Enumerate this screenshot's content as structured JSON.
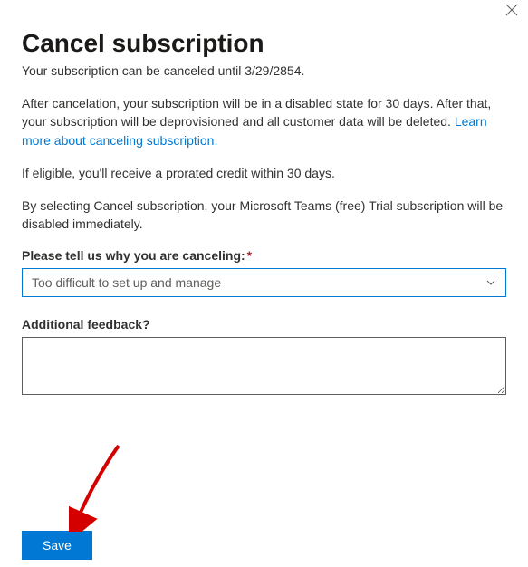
{
  "dialog": {
    "title": "Cancel subscription",
    "subtitle": "Your subscription can be canceled until 3/29/2854.",
    "paragraph1_a": "After cancelation, your subscription will be in a disabled state for 30 days. After that, your subscription will be deprovisioned and all customer data will be deleted. ",
    "learn_more_link": "Learn more about canceling subscription.",
    "paragraph2": "If eligible, you'll receive a prorated credit within 30 days.",
    "paragraph3": "By selecting Cancel subscription, your Microsoft Teams (free) Trial subscription will be disabled immediately."
  },
  "form": {
    "reason_label": "Please tell us why you are canceling:",
    "reason_selected": "Too difficult to set up and manage",
    "feedback_label": "Additional feedback?",
    "feedback_value": ""
  },
  "buttons": {
    "save": "Save"
  }
}
